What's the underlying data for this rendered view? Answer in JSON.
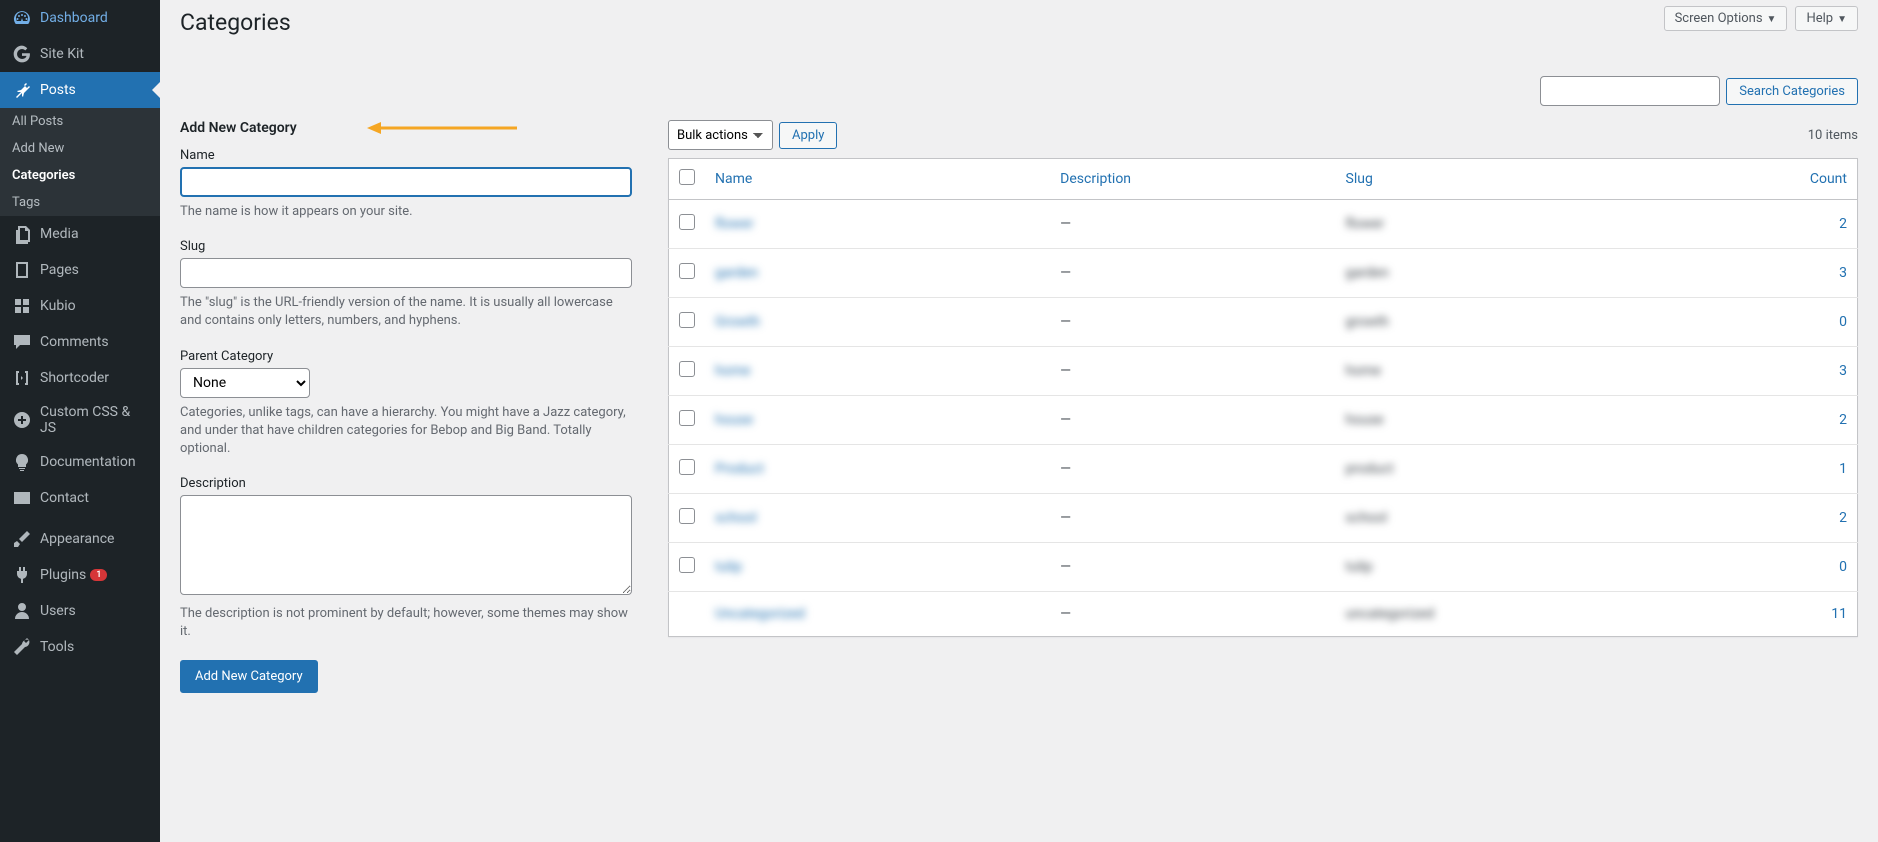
{
  "sidebar": {
    "items": [
      {
        "label": "Dashboard",
        "id": "dashboard"
      },
      {
        "label": "Site Kit",
        "id": "sitekit"
      },
      {
        "label": "Posts",
        "id": "posts",
        "current": true,
        "sub": [
          {
            "label": "All Posts",
            "id": "all-posts"
          },
          {
            "label": "Add New",
            "id": "add-new"
          },
          {
            "label": "Categories",
            "id": "categories",
            "current": true
          },
          {
            "label": "Tags",
            "id": "tags"
          }
        ]
      },
      {
        "label": "Media",
        "id": "media"
      },
      {
        "label": "Pages",
        "id": "pages"
      },
      {
        "label": "Kubio",
        "id": "kubio"
      },
      {
        "label": "Comments",
        "id": "comments"
      },
      {
        "label": "Shortcoder",
        "id": "shortcoder"
      },
      {
        "label": "Custom CSS & JS",
        "id": "customcssjs"
      },
      {
        "label": "Documentation",
        "id": "documentation"
      },
      {
        "label": "Contact",
        "id": "contact"
      },
      {
        "label": "Appearance",
        "id": "appearance"
      },
      {
        "label": "Plugins",
        "id": "plugins",
        "badge": "1"
      },
      {
        "label": "Users",
        "id": "users"
      },
      {
        "label": "Tools",
        "id": "tools"
      }
    ]
  },
  "top": {
    "screen_options": "Screen Options",
    "help": "Help"
  },
  "page_title": "Categories",
  "search": {
    "button": "Search Categories",
    "value": ""
  },
  "form": {
    "heading": "Add New Category",
    "name_label": "Name",
    "name_help": "The name is how it appears on your site.",
    "slug_label": "Slug",
    "slug_help": "The \"slug\" is the URL-friendly version of the name. It is usually all lowercase and contains only letters, numbers, and hyphens.",
    "parent_label": "Parent Category",
    "parent_option": "None",
    "parent_help": "Categories, unlike tags, can have a hierarchy. You might have a Jazz category, and under that have children categories for Bebop and Big Band. Totally optional.",
    "desc_label": "Description",
    "desc_help": "The description is not prominent by default; however, some themes may show it.",
    "submit": "Add New Category"
  },
  "table": {
    "bulk_option": "Bulk actions",
    "apply": "Apply",
    "items_count": "10 items",
    "columns": {
      "name": "Name",
      "description": "Description",
      "slug": "Slug",
      "count": "Count"
    },
    "rows": [
      {
        "name": "flower",
        "desc": "—",
        "slug": "flower",
        "count": "2"
      },
      {
        "name": "garden",
        "desc": "—",
        "slug": "garden",
        "count": "3"
      },
      {
        "name": "Growth",
        "desc": "—",
        "slug": "growth",
        "count": "0"
      },
      {
        "name": "home",
        "desc": "—",
        "slug": "home",
        "count": "3"
      },
      {
        "name": "house",
        "desc": "—",
        "slug": "house",
        "count": "2"
      },
      {
        "name": "Product",
        "desc": "—",
        "slug": "product",
        "count": "1"
      },
      {
        "name": "school",
        "desc": "—",
        "slug": "school",
        "count": "2"
      },
      {
        "name": "tulip",
        "desc": "—",
        "slug": "tulip",
        "count": "0"
      },
      {
        "name": "Uncategorized",
        "desc": "—",
        "slug": "uncategorized",
        "count": "11"
      }
    ]
  }
}
